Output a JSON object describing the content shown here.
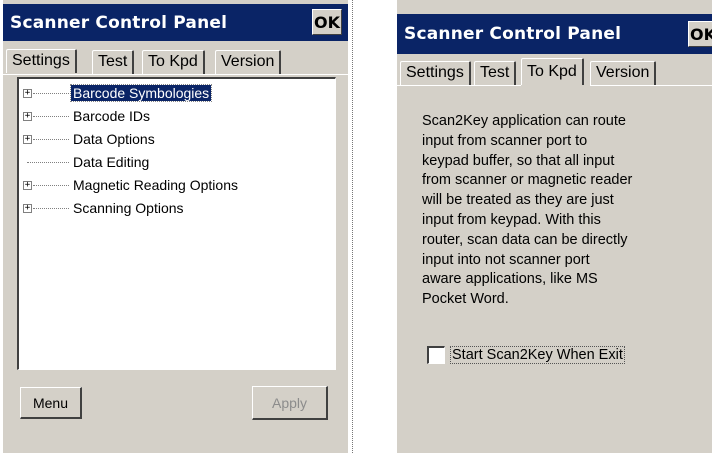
{
  "left": {
    "title": "Scanner Control Panel",
    "ok_label": "OK",
    "tabs": [
      {
        "label": "Settings",
        "active": true
      },
      {
        "label": "Test",
        "active": false
      },
      {
        "label": "To Kpd",
        "active": false
      },
      {
        "label": "Version",
        "active": false
      }
    ],
    "tree": [
      {
        "label": "Barcode Symbologies",
        "expandable": true,
        "selected": true
      },
      {
        "label": "Barcode IDs",
        "expandable": true,
        "selected": false
      },
      {
        "label": "Data Options",
        "expandable": true,
        "selected": false
      },
      {
        "label": "Data Editing",
        "expandable": false,
        "selected": false
      },
      {
        "label": "Magnetic Reading Options",
        "expandable": true,
        "selected": false
      },
      {
        "label": "Scanning Options",
        "expandable": true,
        "selected": false
      }
    ],
    "menu_label": "Menu",
    "apply_label": "Apply"
  },
  "right": {
    "title": "Scanner Control Panel",
    "ok_label": "OK",
    "tabs": [
      {
        "label": "Settings",
        "active": false
      },
      {
        "label": "Test",
        "active": false
      },
      {
        "label": "To Kpd",
        "active": true
      },
      {
        "label": "Version",
        "active": false
      }
    ],
    "description_lines": [
      "Scan2Key application can route",
      "input from scanner port to",
      "keypad buffer, so that all input",
      "from scanner or magnetic reader",
      "will be treated as they are just",
      "input from keypad. With this",
      "router, scan data can be directly",
      "input into not scanner port",
      "aware applications, like MS",
      "Pocket Word."
    ],
    "checkbox_label": "Start Scan2Key When Exit",
    "checkbox_checked": false
  },
  "colors": {
    "titlebar": "#0a2466",
    "face": "#d4d0c8",
    "selection": "#0a2466"
  }
}
